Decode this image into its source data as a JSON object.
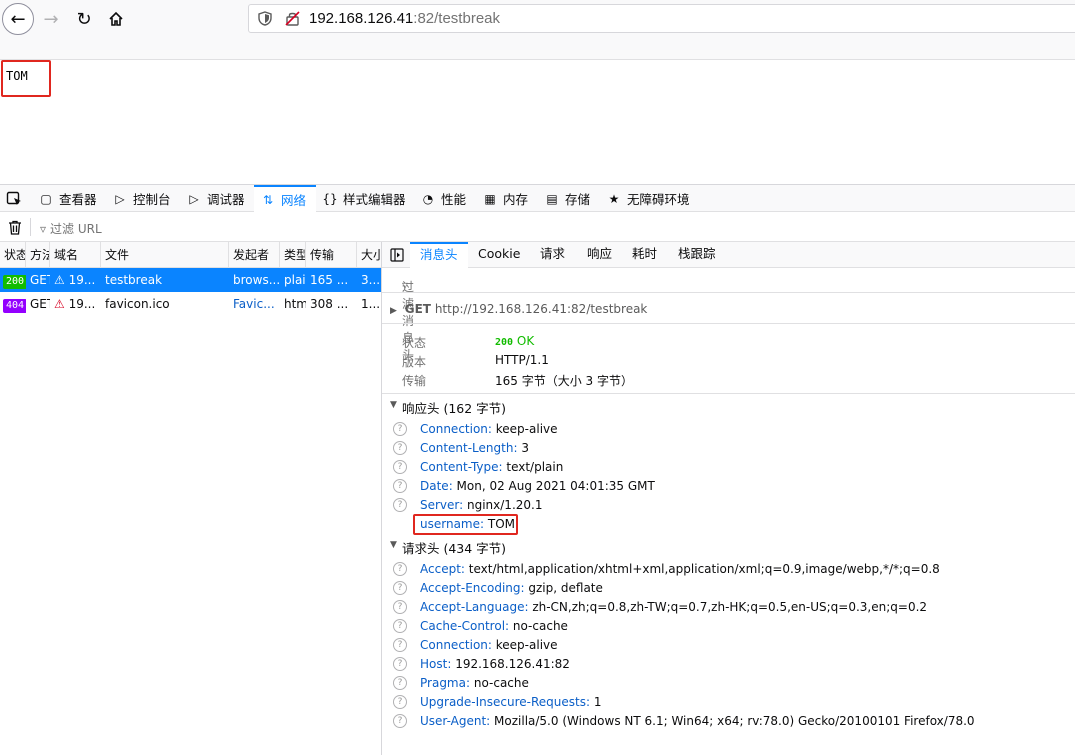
{
  "browser": {
    "url_host": "192.168.126.41",
    "url_rest": ":82/testbreak"
  },
  "page": {
    "body_text": "TOM"
  },
  "devtools": {
    "tabs": [
      {
        "label": "查看器",
        "icon": "inspector-icon"
      },
      {
        "label": "控制台",
        "icon": "console-icon"
      },
      {
        "label": "调试器",
        "icon": "debugger-icon"
      },
      {
        "label": "网络",
        "icon": "network-icon",
        "active": true
      },
      {
        "label": "样式编辑器",
        "icon": "style-editor-icon"
      },
      {
        "label": "性能",
        "icon": "performance-icon"
      },
      {
        "label": "内存",
        "icon": "memory-icon"
      },
      {
        "label": "存储",
        "icon": "storage-icon"
      },
      {
        "label": "无障碍环境",
        "icon": "accessibility-icon"
      }
    ],
    "filter_url_placeholder": "过滤 URL",
    "columns": [
      "状态",
      "方法",
      "域名",
      "文件",
      "发起者",
      "类型",
      "传输",
      "大小"
    ],
    "requests": [
      {
        "status": "200",
        "method": "GET",
        "domain": "19...",
        "file": "testbreak",
        "initiator": "brows...",
        "type": "plai",
        "transfer": "165 ...",
        "size": "3..."
      },
      {
        "status": "404",
        "method": "GET",
        "domain": "19...",
        "file": "favicon.ico",
        "initiator": "Favic...",
        "type": "htm",
        "transfer": "308 ...",
        "size": "1..."
      }
    ],
    "detail_tabs": [
      "消息头",
      "Cookie",
      "请求",
      "响应",
      "耗时",
      "栈跟踪"
    ],
    "filter_headers_placeholder": "过滤消息头",
    "request_line": {
      "method": "GET",
      "url": "http://192.168.126.41:82/testbreak"
    },
    "summary": {
      "status_label": "状态",
      "status_code": "200",
      "status_text": "OK",
      "version_label": "版本",
      "version": "HTTP/1.1",
      "transfer_label": "传输",
      "transfer": "165 字节（大小 3 字节）"
    },
    "response_headers_title": "响应头 (162 字节)",
    "response_headers": [
      {
        "name": "Connection",
        "value": "keep-alive"
      },
      {
        "name": "Content-Length",
        "value": "3"
      },
      {
        "name": "Content-Type",
        "value": "text/plain"
      },
      {
        "name": "Date",
        "value": "Mon, 02 Aug 2021 04:01:35 GMT"
      },
      {
        "name": "Server",
        "value": "nginx/1.20.1"
      },
      {
        "name": "username",
        "value": "TOM"
      }
    ],
    "request_headers_title": "请求头 (434 字节)",
    "request_headers": [
      {
        "name": "Accept",
        "value": "text/html,application/xhtml+xml,application/xml;q=0.9,image/webp,*/*;q=0.8"
      },
      {
        "name": "Accept-Encoding",
        "value": "gzip, deflate"
      },
      {
        "name": "Accept-Language",
        "value": "zh-CN,zh;q=0.8,zh-TW;q=0.7,zh-HK;q=0.5,en-US;q=0.3,en;q=0.2"
      },
      {
        "name": "Cache-Control",
        "value": "no-cache"
      },
      {
        "name": "Connection",
        "value": "keep-alive"
      },
      {
        "name": "Host",
        "value": "192.168.126.41:82"
      },
      {
        "name": "Pragma",
        "value": "no-cache"
      },
      {
        "name": "Upgrade-Insecure-Requests",
        "value": "1"
      },
      {
        "name": "User-Agent",
        "value": "Mozilla/5.0 (Windows NT 6.1; Win64; x64; rv:78.0) Gecko/20100101 Firefox/78.0"
      }
    ]
  },
  "colors": {
    "accent": "#0a84ff",
    "status_ok": "#12bc00",
    "status_404": "#9400ff",
    "annotation": "#e0271f"
  }
}
